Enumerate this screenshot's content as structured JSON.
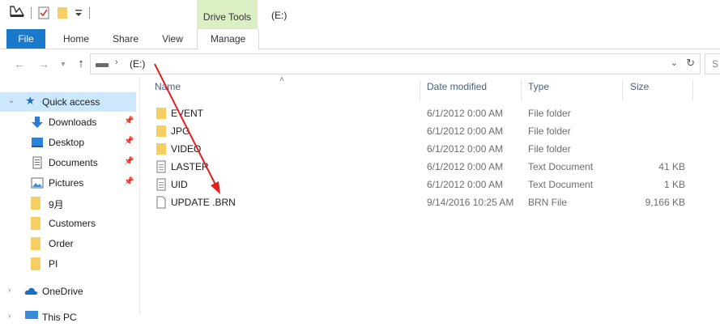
{
  "titlebar": {
    "context_tab": "Drive Tools",
    "window_title": "(E:)"
  },
  "ribbon": {
    "tabs": [
      "File",
      "Home",
      "Share",
      "View",
      "Manage"
    ]
  },
  "address": {
    "path_label": "(E:)",
    "search_fragment": "S"
  },
  "nav": {
    "quick_access": "Quick access",
    "pinned": [
      {
        "label": "Downloads",
        "icon": "downloads-icon"
      },
      {
        "label": "Desktop",
        "icon": "desktop-icon"
      },
      {
        "label": "Documents",
        "icon": "documents-icon"
      },
      {
        "label": "Pictures",
        "icon": "pictures-icon"
      }
    ],
    "folders": [
      "9月",
      "Customers",
      "Order",
      "PI"
    ],
    "onedrive": "OneDrive",
    "this_pc": "This PC"
  },
  "columns": {
    "name": "Name",
    "date": "Date modified",
    "type": "Type",
    "size": "Size"
  },
  "files": [
    {
      "name": "EVENT",
      "date": "6/1/2012 0:00 AM",
      "type": "File folder",
      "size": "",
      "icon": "folder-icon"
    },
    {
      "name": "JPG",
      "date": "6/1/2012 0:00 AM",
      "type": "File folder",
      "size": "",
      "icon": "folder-icon"
    },
    {
      "name": "VIDEO",
      "date": "6/1/2012 0:00 AM",
      "type": "File folder",
      "size": "",
      "icon": "folder-icon"
    },
    {
      "name": "LASTER",
      "date": "6/1/2012 0:00 AM",
      "type": "Text Document",
      "size": "41 KB",
      "icon": "text-file-icon"
    },
    {
      "name": "UID",
      "date": "6/1/2012 0:00 AM",
      "type": "Text Document",
      "size": "1 KB",
      "icon": "text-file-icon"
    },
    {
      "name": "UPDATE .BRN",
      "date": "9/14/2016 10:25 AM",
      "type": "BRN File",
      "size": "9,166 KB",
      "icon": "file-icon"
    }
  ],
  "colors": {
    "file_tab": "#1979ca",
    "drive_tools": "#dceec3",
    "quick_access_highlight": "#cce8ff",
    "folder": "#f6cf63",
    "annotation_arrow": "#e02020"
  }
}
